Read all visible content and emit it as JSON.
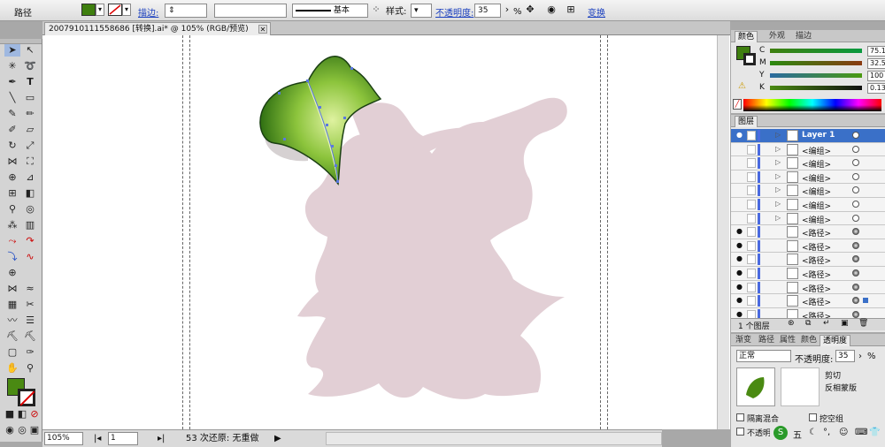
{
  "control_bar": {
    "selection_type": "路径",
    "stroke_label": "描边:",
    "stroke_style_label": "基本",
    "style_label": "样式:",
    "opacity_label": "不透明度:",
    "opacity_value": "35",
    "opacity_unit": "%",
    "transform_label": "变换",
    "fill_color": "#3f7f0f"
  },
  "document": {
    "tab_title": "2007910111558686 [转换].ai* @ 105% (RGB/预览)",
    "close_glyph": "✕"
  },
  "status_bar": {
    "zoom": "105%",
    "artboard": "1",
    "history": "53 次还原: 无重做"
  },
  "color_panel": {
    "tabs": [
      "颜色",
      "外观",
      "描边"
    ],
    "channels": [
      {
        "label": "C",
        "value": "75.1",
        "unit": "%"
      },
      {
        "label": "M",
        "value": "32.58",
        "unit": "%"
      },
      {
        "label": "Y",
        "value": "100",
        "unit": "%"
      },
      {
        "label": "K",
        "value": "0.13",
        "unit": "%"
      }
    ],
    "fill_color": "#3f7f0f"
  },
  "layers_panel": {
    "tab": "图层",
    "rows": [
      {
        "name": "Layer 1",
        "kind": "layer",
        "top": true
      },
      {
        "name": "<编组>",
        "kind": "group"
      },
      {
        "name": "<编组>",
        "kind": "group"
      },
      {
        "name": "<编组>",
        "kind": "group"
      },
      {
        "name": "<编组>",
        "kind": "group"
      },
      {
        "name": "<编组>",
        "kind": "group"
      },
      {
        "name": "<编组>",
        "kind": "group"
      },
      {
        "name": "<路径>",
        "kind": "path"
      },
      {
        "name": "<路径>",
        "kind": "path"
      },
      {
        "name": "<路径>",
        "kind": "path"
      },
      {
        "name": "<路径>",
        "kind": "path"
      },
      {
        "name": "<路径>",
        "kind": "path"
      },
      {
        "name": "<路径>",
        "kind": "path"
      },
      {
        "name": "<路径>",
        "kind": "path"
      }
    ],
    "footer": "1 个图层"
  },
  "transparency_panel": {
    "tabs": [
      "渐变",
      "路径",
      "属性",
      "颜色",
      "透明度"
    ],
    "blend_mode": "正常",
    "opacity_label": "不透明度:",
    "opacity_value": "35",
    "opacity_unit": "%",
    "clip_label": "剪切",
    "invert_mask_label": "反相蒙版",
    "isolate_label": "隔离混合",
    "knockout_label": "挖空组",
    "opacity_mask_label": "不透明"
  }
}
